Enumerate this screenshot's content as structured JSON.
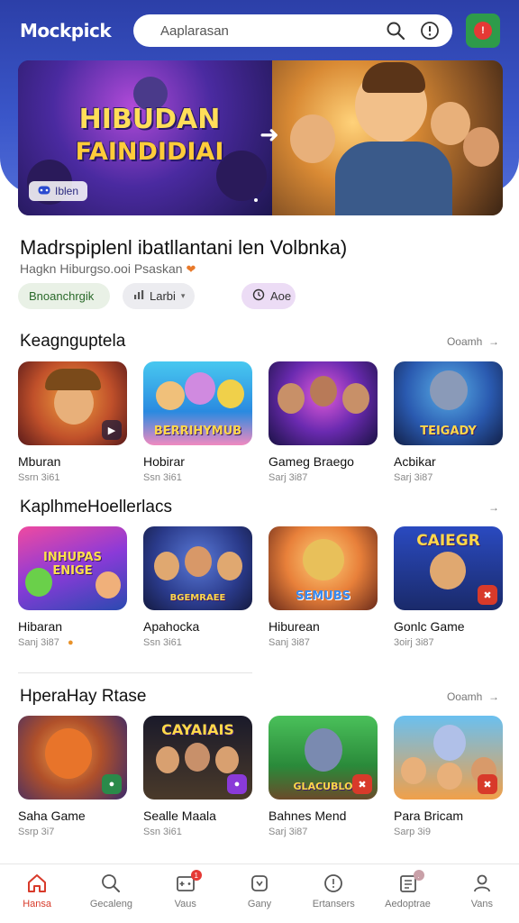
{
  "header": {
    "logo_text": "Mockpick",
    "search_placeholder": "Aaplarasan",
    "profile_badge": "!"
  },
  "banner": {
    "title_line1": "HIBUDAN",
    "title_line2": "FAINDIDIAI",
    "tag_label": "Iblen"
  },
  "app": {
    "title": "Madrspiplenl ibatllantani len Volbnka)",
    "subtitle": "Hagkn Hiburgso.ooi Psaskan",
    "chips": [
      {
        "label": "Bnoanchrgik"
      },
      {
        "label": "Larbi"
      },
      {
        "label": "Aoe"
      }
    ]
  },
  "sections": [
    {
      "title": "Keagnguptela",
      "more": "Ooamh",
      "items": [
        {
          "name": "Mburan",
          "meta": "Ssrn 3i61",
          "thumb_label": "",
          "colors": [
            "#e0762a",
            "#7a2a1a"
          ]
        },
        {
          "name": "Hobirar",
          "meta": "Ssn 3i61",
          "thumb_label": "BERRIHYMUB",
          "colors": [
            "#38c0e0",
            "#2a6ab0"
          ]
        },
        {
          "name": "Gameg Braego",
          "meta": "Sarj 3i87",
          "thumb_label": "",
          "colors": [
            "#8a3ad8",
            "#2a1a6a"
          ]
        },
        {
          "name": "Acbikar",
          "meta": "Sarj 3i87",
          "thumb_label": "TEIGADY",
          "colors": [
            "#3a8ad0",
            "#1a2a5a"
          ]
        }
      ]
    },
    {
      "title": "KaplhmeHoellerlacs",
      "more": "",
      "items": [
        {
          "name": "Hibaran",
          "meta": "Sanj 3i87",
          "thumb_label": "INHUPAS ENIGE",
          "colors": [
            "#c04ad0",
            "#3a2a8a"
          ]
        },
        {
          "name": "Apahocka",
          "meta": "Ssn 3i61",
          "thumb_label": "BGEMRAEE",
          "colors": [
            "#3a6ad0",
            "#1a2a6a"
          ]
        },
        {
          "name": "Hiburean",
          "meta": "Sanj 3i87",
          "thumb_label": "SEMUBS",
          "colors": [
            "#f0a03a",
            "#a0502a"
          ]
        },
        {
          "name": "Gonlc Game",
          "meta": "3oirj 3i87",
          "thumb_label": "CAIEGR",
          "colors": [
            "#3a5ad0",
            "#1a1a4a"
          ]
        }
      ]
    },
    {
      "title": "HperaHay Rtase",
      "more": "Ooamh",
      "items": [
        {
          "name": "Saha Game",
          "meta": "Ssrp 3i7",
          "thumb_label": "",
          "colors": [
            "#e07a2a",
            "#3a2a6a"
          ]
        },
        {
          "name": "Sealle Maala",
          "meta": "Ssn 3i61",
          "thumb_label": "CAYAIAIS",
          "colors": [
            "#2a2a2a",
            "#6a4a1a"
          ]
        },
        {
          "name": "Bahnes Mend",
          "meta": "Sarj 3i87",
          "thumb_label": "GLACUBLO",
          "colors": [
            "#3ab04a",
            "#2a6a2a"
          ]
        },
        {
          "name": "Para Bricam",
          "meta": "Sarp 3i9",
          "thumb_label": "",
          "colors": [
            "#58b8f0",
            "#e06a3a"
          ]
        }
      ]
    }
  ],
  "bottom_nav": [
    {
      "label": "Hansa",
      "icon": "home-icon",
      "active": true
    },
    {
      "label": "Gecaleng",
      "icon": "search-icon"
    },
    {
      "label": "Vaus",
      "icon": "games-icon",
      "badge": "1"
    },
    {
      "label": "Gany",
      "icon": "apps-icon"
    },
    {
      "label": "Ertansers",
      "icon": "compass-icon"
    },
    {
      "label": "Aedoptrae",
      "icon": "news-icon",
      "badge": "."
    },
    {
      "label": "Vans",
      "icon": "profile-icon"
    }
  ],
  "colors": {
    "header_blue": "#3a56c9",
    "accent_red": "#d83a2a",
    "chip_green": "#e9f1e6",
    "chip_purple": "#ecdcf5"
  }
}
